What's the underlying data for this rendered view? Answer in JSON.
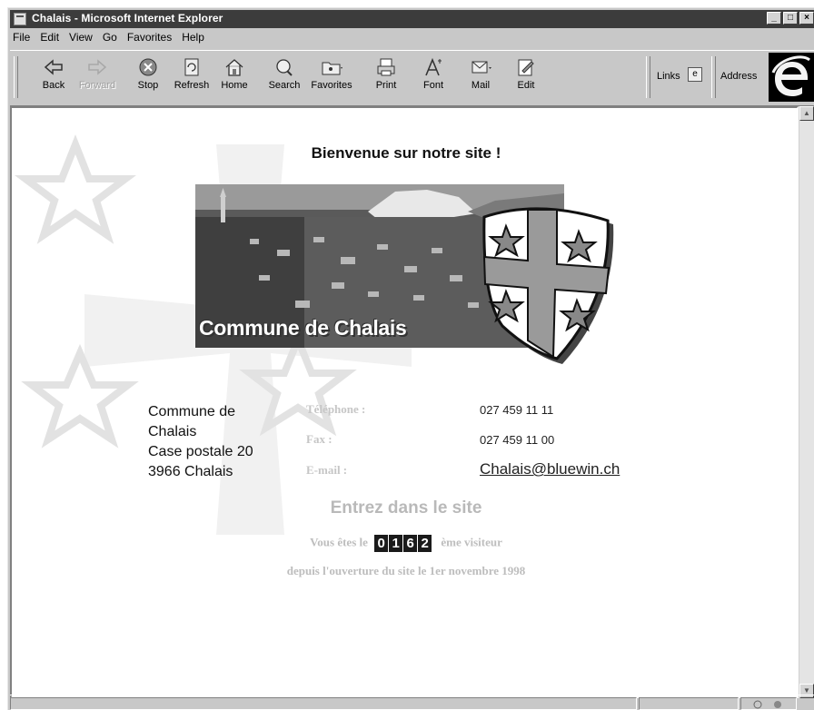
{
  "window": {
    "title": "Chalais - Microsoft Internet Explorer"
  },
  "menu": [
    "File",
    "Edit",
    "View",
    "Go",
    "Favorites",
    "Help"
  ],
  "toolbar": {
    "back": "Back",
    "forward": "Forward",
    "stop": "Stop",
    "refresh": "Refresh",
    "home": "Home",
    "search": "Search",
    "favorites": "Favorites",
    "print": "Print",
    "font": "Font",
    "mail": "Mail",
    "edit": "Edit",
    "links": "Links",
    "address": "Address"
  },
  "page": {
    "heading": "Bienvenue sur notre site !",
    "banner_caption": "Commune de Chalais",
    "address_lines": [
      "Commune de",
      "Chalais",
      "Case postale 20",
      "3966 Chalais"
    ],
    "phone_label": "Téléphone :",
    "phone": "027 459 11 11",
    "fax_label": "Fax :",
    "fax": "027 459 11 00",
    "email_label": "E-mail :",
    "email": "Chalais@bluewin.ch",
    "enter_link": "Entrez dans le site",
    "visitor_prefix": "Vous êtes le",
    "visitor_digits": [
      "0",
      "1",
      "6",
      "2"
    ],
    "visitor_suffix": "ème visiteur",
    "since": "depuis l'ouverture du site le 1er novembre 1998"
  },
  "colors": {
    "titlebar": "#3c3c3c",
    "chrome": "#c8c8c8",
    "faded_text": "#bdbdbd"
  }
}
